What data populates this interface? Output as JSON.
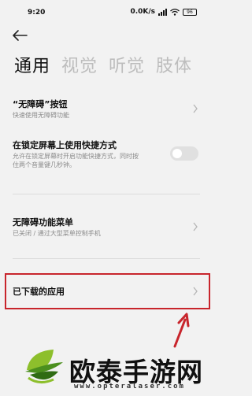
{
  "status_bar": {
    "time": "9:20",
    "speed": "0.0K/s",
    "battery": "96",
    "icons": [
      "signal-icon",
      "wifi-icon",
      "battery-icon"
    ]
  },
  "header": {
    "back_icon": "back-arrow-icon"
  },
  "tabs": [
    {
      "label": "通用",
      "active": true
    },
    {
      "label": "视觉",
      "active": false
    },
    {
      "label": "听觉",
      "active": false
    },
    {
      "label": "肢体",
      "active": false
    }
  ],
  "items": {
    "shortcut_button": {
      "title": "“无障碍”按钮",
      "subtitle": "快速使用无障碍功能"
    },
    "lock_screen_shortcut": {
      "title": "在锁定屏幕上使用快捷方式",
      "subtitle_line1": "允许在锁定屏幕时开启功能快捷方式，同时按",
      "subtitle_line2": "住两个音量键几秒钟。",
      "toggle_on": false
    },
    "accessibility_menu": {
      "title": "无障碍功能菜单",
      "subtitle": "已关闭 / 通过大型菜单控制手机"
    },
    "downloaded_apps": {
      "title": "已下载的应用"
    }
  },
  "annotation": {
    "highlight_color": "#c8252c"
  },
  "watermark": {
    "name": "欧泰手游网",
    "url": "www.opteralaser.com"
  }
}
